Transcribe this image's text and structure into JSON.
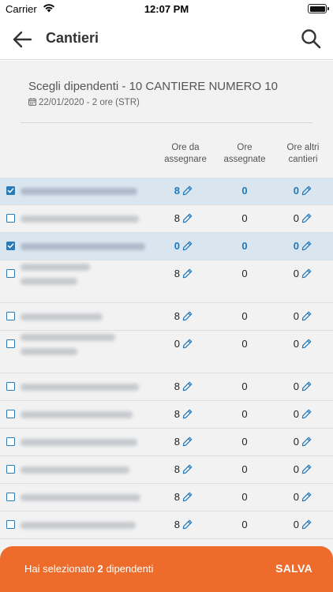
{
  "status_bar": {
    "carrier": "Carrier",
    "time": "12:07 PM"
  },
  "nav": {
    "title": "Cantieri"
  },
  "header": {
    "subtitle": "Scegli dipendenti - 10 CANTIERE NUMERO 10",
    "meta": "22/01/2020 - 2 ore (STR)"
  },
  "columns": {
    "col1": [
      "Ore da",
      "assegnare"
    ],
    "col2": [
      "Ore",
      "assegnate"
    ],
    "col3": [
      "Ore altri",
      "cantieri"
    ]
  },
  "rows": [
    {
      "selected": true,
      "ore_da_assegnare": "8",
      "ore_assegnate": "0",
      "ore_altri_cantieri": "0"
    },
    {
      "selected": false,
      "ore_da_assegnare": "8",
      "ore_assegnate": "0",
      "ore_altri_cantieri": "0"
    },
    {
      "selected": true,
      "ore_da_assegnare": "0",
      "ore_assegnate": "0",
      "ore_altri_cantieri": "0"
    },
    {
      "selected": false,
      "ore_da_assegnare": "8",
      "ore_assegnate": "0",
      "ore_altri_cantieri": "0"
    },
    {
      "selected": false,
      "ore_da_assegnare": "8",
      "ore_assegnate": "0",
      "ore_altri_cantieri": "0"
    },
    {
      "selected": false,
      "ore_da_assegnare": "0",
      "ore_assegnate": "0",
      "ore_altri_cantieri": "0"
    },
    {
      "selected": false,
      "ore_da_assegnare": "8",
      "ore_assegnate": "0",
      "ore_altri_cantieri": "0"
    },
    {
      "selected": false,
      "ore_da_assegnare": "8",
      "ore_assegnate": "0",
      "ore_altri_cantieri": "0"
    },
    {
      "selected": false,
      "ore_da_assegnare": "8",
      "ore_assegnate": "0",
      "ore_altri_cantieri": "0"
    },
    {
      "selected": false,
      "ore_da_assegnare": "8",
      "ore_assegnate": "0",
      "ore_altri_cantieri": "0"
    },
    {
      "selected": false,
      "ore_da_assegnare": "8",
      "ore_assegnate": "0",
      "ore_altri_cantieri": "0"
    },
    {
      "selected": false,
      "ore_da_assegnare": "8",
      "ore_assegnate": "0",
      "ore_altri_cantieri": "0"
    }
  ],
  "bottom": {
    "prefix": "Hai selezionato ",
    "count": "2",
    "suffix": " dipendenti",
    "save_label": "SALVA"
  },
  "colors": {
    "accent": "#1f77b9",
    "bottom_bar": "#ed6c2c",
    "selected_row": "#dae6ef"
  },
  "icons": [
    "back-arrow-icon",
    "search-icon",
    "calendar-icon",
    "pencil-icon",
    "checkbox-icon",
    "wifi-icon",
    "battery-icon"
  ]
}
